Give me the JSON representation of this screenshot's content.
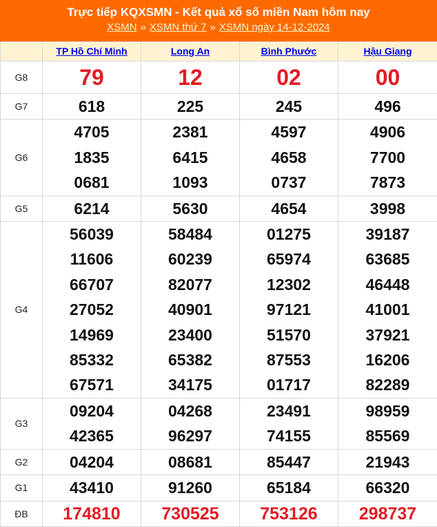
{
  "header": {
    "title": "Trực tiếp KQXSMN - Kết quả xổ số miền Nam hôm nay",
    "crumbs": [
      "XSMN",
      "XSMN thứ 7",
      "XSMN ngày 14-12-2024"
    ],
    "separator": "»"
  },
  "provinces": [
    "TP Hồ Chí Minh",
    "Long An",
    "Bình Phước",
    "Hậu Giang"
  ],
  "prizes": [
    {
      "label": "G8",
      "values": [
        [
          "79"
        ],
        [
          "12"
        ],
        [
          "02"
        ],
        [
          "00"
        ]
      ]
    },
    {
      "label": "G7",
      "values": [
        [
          "618"
        ],
        [
          "225"
        ],
        [
          "245"
        ],
        [
          "496"
        ]
      ]
    },
    {
      "label": "G6",
      "values": [
        [
          "4705",
          "1835",
          "0681"
        ],
        [
          "2381",
          "6415",
          "1093"
        ],
        [
          "4597",
          "4658",
          "0737"
        ],
        [
          "4906",
          "7700",
          "7873"
        ]
      ]
    },
    {
      "label": "G5",
      "values": [
        [
          "6214"
        ],
        [
          "5630"
        ],
        [
          "4654"
        ],
        [
          "3998"
        ]
      ]
    },
    {
      "label": "G4",
      "values": [
        [
          "56039",
          "11606",
          "66707",
          "27052",
          "14969",
          "85332",
          "67571"
        ],
        [
          "58484",
          "60239",
          "82077",
          "40901",
          "23400",
          "65382",
          "34175"
        ],
        [
          "01275",
          "65974",
          "12302",
          "97121",
          "51570",
          "87553",
          "01717"
        ],
        [
          "39187",
          "63685",
          "46448",
          "41001",
          "37921",
          "16206",
          "82289"
        ]
      ]
    },
    {
      "label": "G3",
      "values": [
        [
          "09204",
          "42365"
        ],
        [
          "04268",
          "96297"
        ],
        [
          "23491",
          "74155"
        ],
        [
          "98959",
          "85569"
        ]
      ]
    },
    {
      "label": "G2",
      "values": [
        [
          "04204"
        ],
        [
          "08681"
        ],
        [
          "85447"
        ],
        [
          "21943"
        ]
      ]
    },
    {
      "label": "G1",
      "values": [
        [
          "43410"
        ],
        [
          "91260"
        ],
        [
          "65184"
        ],
        [
          "66320"
        ]
      ]
    },
    {
      "label": "ĐB",
      "values": [
        [
          "174810"
        ],
        [
          "730525"
        ],
        [
          "753126"
        ],
        [
          "298737"
        ]
      ]
    }
  ],
  "colors": {
    "header_bg": "#ff6a00",
    "prize_highlight": "#e21b23",
    "link": "#0000ee",
    "province_row_bg": "#fff3d1"
  }
}
